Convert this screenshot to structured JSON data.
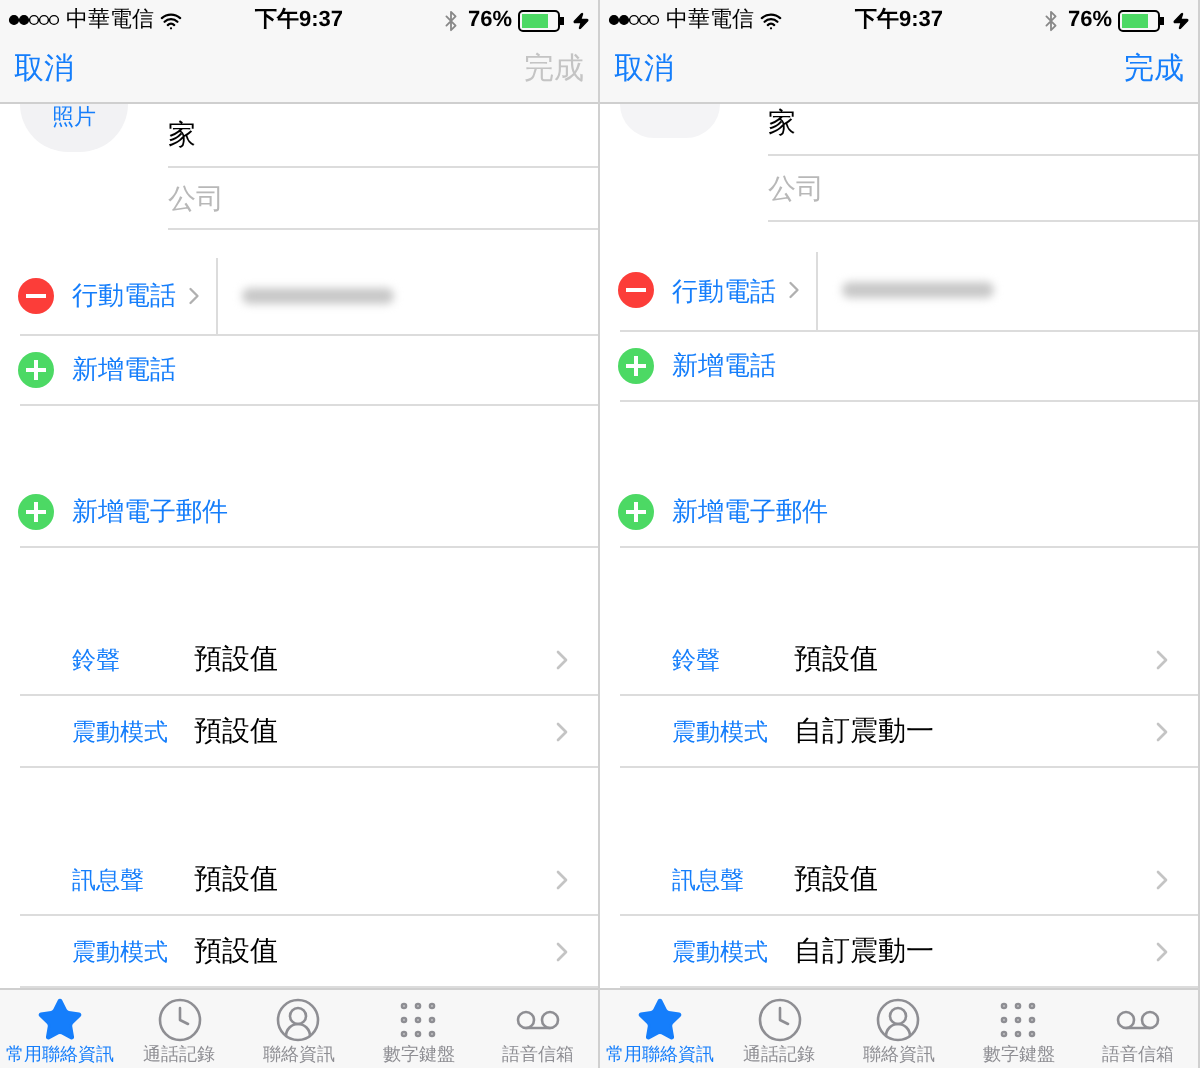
{
  "panels": [
    {
      "status_bar": {
        "carrier": "中華電信",
        "time": "下午9:37",
        "battery": "76%"
      },
      "nav": {
        "cancel": "取消",
        "done": {
          "label": "完成",
          "disabled": true
        }
      },
      "avatar_label": "照片",
      "fields": [
        "家",
        "公司"
      ],
      "phone": {
        "label": "行動電話"
      },
      "add_phone": "新增電話",
      "add_email": "新增電子郵件",
      "sections": [
        [
          {
            "label": "鈴聲",
            "value": "預設值"
          },
          {
            "label": "震動模式",
            "value": "預設值"
          }
        ],
        [
          {
            "label": "訊息聲",
            "value": "預設值"
          },
          {
            "label": "震動模式",
            "value": "預設值"
          }
        ]
      ],
      "tab_bar": [
        {
          "kind": "star",
          "label": "常用聯絡資訊",
          "selected": true
        },
        {
          "kind": "clock",
          "label": "通話記錄",
          "selected": false
        },
        {
          "kind": "person",
          "label": "聯絡資訊",
          "selected": false
        },
        {
          "kind": "keypad",
          "label": "數字鍵盤",
          "selected": false
        },
        {
          "kind": "voicemail",
          "label": "語音信箱",
          "selected": false
        }
      ]
    },
    {
      "status_bar": {
        "carrier": "中華電信",
        "time": "下午9:37",
        "battery": "76%"
      },
      "nav": {
        "cancel": "取消",
        "done": {
          "label": "完成",
          "disabled": false
        }
      },
      "fields": [
        "家",
        "公司"
      ],
      "phone": {
        "label": "行動電話"
      },
      "add_phone": "新增電話",
      "add_email": "新增電子郵件",
      "sections": [
        [
          {
            "label": "鈴聲",
            "value": "預設值"
          },
          {
            "label": "震動模式",
            "value": "自訂震動一"
          }
        ],
        [
          {
            "label": "訊息聲",
            "value": "預設值"
          },
          {
            "label": "震動模式",
            "value": "自訂震動一"
          }
        ]
      ],
      "tab_bar": [
        {
          "kind": "star",
          "label": "常用聯絡資訊",
          "selected": true
        },
        {
          "kind": "clock",
          "label": "通話記錄",
          "selected": false
        },
        {
          "kind": "person",
          "label": "聯絡資訊",
          "selected": false
        },
        {
          "kind": "keypad",
          "label": "數字鍵盤",
          "selected": false
        },
        {
          "kind": "voicemail",
          "label": "語音信箱",
          "selected": false
        }
      ]
    }
  ]
}
